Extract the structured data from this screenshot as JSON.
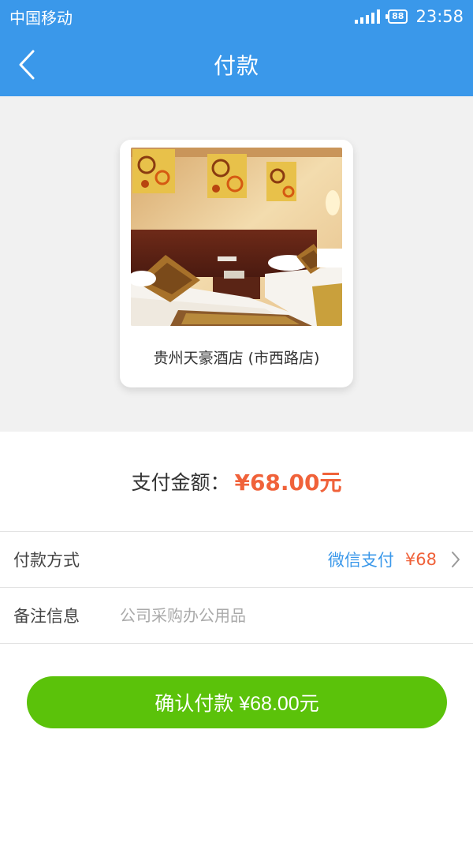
{
  "status_bar": {
    "carrier": "中国移动",
    "battery": "88",
    "time": "23:58"
  },
  "nav": {
    "title": "付款"
  },
  "hotel": {
    "name": "贵州天豪酒店 (市西路店)"
  },
  "payment": {
    "amount_label": "支付金额：",
    "amount_value": "¥68.00元"
  },
  "method_row": {
    "label": "付款方式",
    "method": "微信支付",
    "amount": "¥68"
  },
  "remark_row": {
    "label": "备注信息",
    "placeholder": "公司采购办公用品"
  },
  "confirm": {
    "label": "确认付款 ¥68.00元"
  },
  "colors": {
    "header": "#3a98ea",
    "accent_orange": "#f0623a",
    "confirm_green": "#5bc20a"
  }
}
